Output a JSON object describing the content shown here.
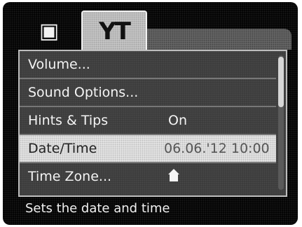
{
  "tabs": [
    {
      "icon": "camera-icon",
      "glyph": "▣"
    },
    {
      "icon": "tools-icon",
      "glyph": "YT"
    }
  ],
  "menu": {
    "items": [
      {
        "label": "Volume...",
        "value": ""
      },
      {
        "label": "Sound Options...",
        "value": ""
      },
      {
        "label": "Hints & Tips",
        "value": "On"
      },
      {
        "label": "Date/Time",
        "value": "06.06.'12 10:00"
      },
      {
        "label": "Time Zone...",
        "value": "",
        "value_icon": "home-icon"
      }
    ],
    "selected_index": 3
  },
  "hint": "Sets the date and time",
  "scrollbar": {
    "position_fraction": 0.0,
    "visible_fraction": 0.38
  }
}
